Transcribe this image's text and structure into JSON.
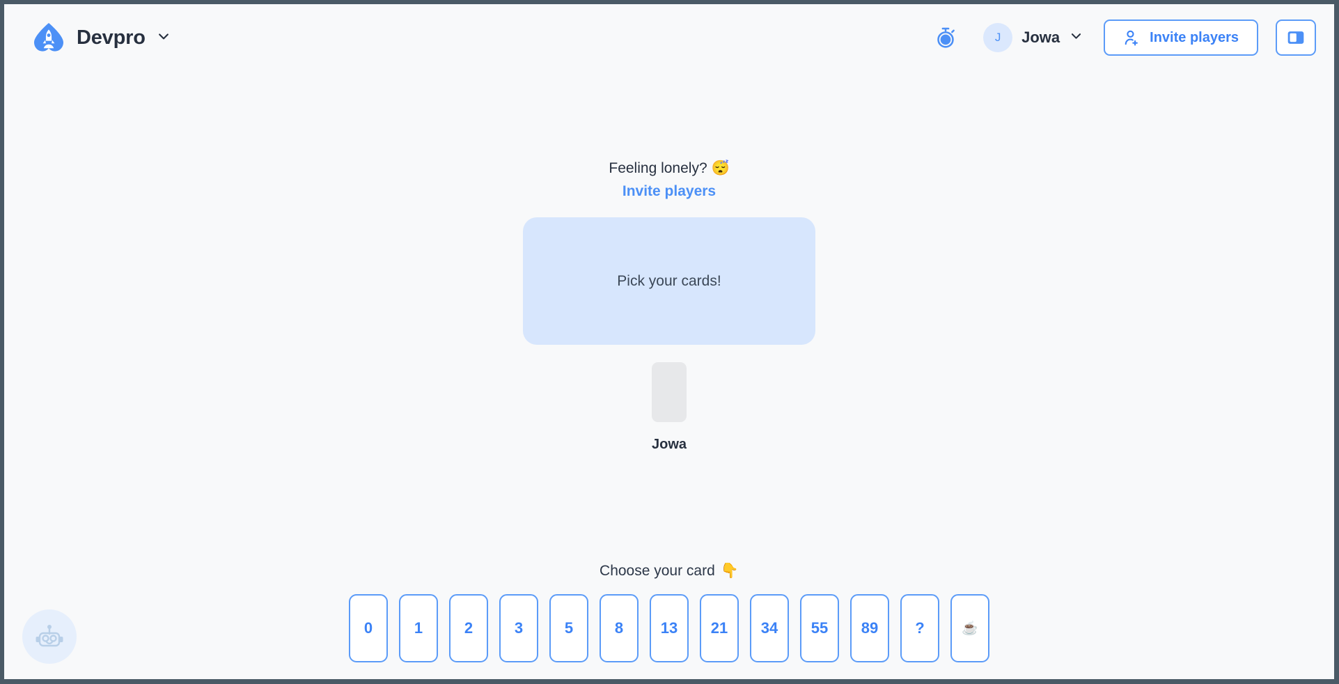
{
  "header": {
    "brand": {
      "name": "Devpro",
      "logo_icon": "rocket-spade-logo",
      "chevron_icon": "chevron-down-icon"
    },
    "timer_icon": "stopwatch-icon",
    "user": {
      "initial": "J",
      "name": "Jowa",
      "chevron_icon": "chevron-down-icon"
    },
    "invite_button": {
      "label": "Invite players",
      "icon": "user-add-icon"
    },
    "panel_toggle": {
      "icon": "sidebar-panel-icon"
    }
  },
  "main": {
    "lonely_text": "Feeling lonely? 😴",
    "invite_link": "Invite players",
    "reveal_panel_text": "Pick your cards!",
    "players": [
      {
        "name": "Jowa",
        "card_value": ""
      }
    ]
  },
  "deck": {
    "prompt": "Choose your card",
    "prompt_emoji": "👇",
    "cards": [
      "0",
      "1",
      "2",
      "3",
      "5",
      "8",
      "13",
      "21",
      "34",
      "55",
      "89",
      "?",
      "☕"
    ]
  },
  "bot": {
    "icon": "robot-icon"
  },
  "colors": {
    "accent": "#4c90f6",
    "accent_border": "#5b9bf8",
    "panel_bg": "#d7e6fd",
    "page_bg": "#f8f9fa",
    "text_dark": "#27303f",
    "card_placeholder": "#e7e8ea",
    "window_frame": "#4a5a66"
  }
}
